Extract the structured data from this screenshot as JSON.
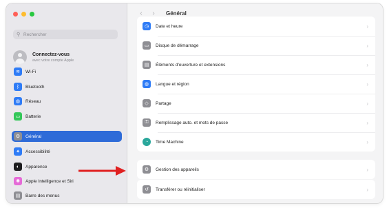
{
  "window": {
    "title": "Général",
    "traffic_colors": [
      "#ff5f57",
      "#febc2e",
      "#28c840"
    ]
  },
  "sidebar": {
    "search_placeholder": "Rechercher",
    "account": {
      "title": "Connectez-vous",
      "subtitle": "avec votre compte Apple"
    },
    "items": [
      {
        "label": "Wi-Fi",
        "icon": "wifi-icon",
        "color": "#2f7cf6",
        "glyph": "≋",
        "selected": false
      },
      {
        "label": "Bluetooth",
        "icon": "bluetooth-icon",
        "color": "#2f7cf6",
        "glyph": "ᛒ",
        "selected": false
      },
      {
        "label": "Réseau",
        "icon": "globe-icon",
        "color": "#2f7cf6",
        "glyph": "◍",
        "selected": false
      },
      {
        "label": "Batterie",
        "icon": "battery-icon",
        "color": "#34c759",
        "glyph": "▭",
        "selected": false
      },
      {
        "label": "Général",
        "icon": "gear-icon",
        "color": "#8e8e93",
        "glyph": "⚙",
        "selected": true
      },
      {
        "label": "Accessibilité",
        "icon": "accessibility-icon",
        "color": "#2f7cf6",
        "glyph": "✦",
        "selected": false
      },
      {
        "label": "Apparence",
        "icon": "appearance-icon",
        "color": "#1c1c1e",
        "glyph": "◐",
        "selected": false
      },
      {
        "label": "Apple Intelligence et Siri",
        "icon": "siri-icon",
        "color": "#e56bd7",
        "glyph": "✺",
        "selected": false
      },
      {
        "label": "Barre des menus",
        "icon": "menubar-icon",
        "color": "#8e8e93",
        "glyph": "▤",
        "selected": false
      }
    ]
  },
  "main": {
    "groups": [
      {
        "rows": [
          {
            "label": "Date et heure",
            "icon": "calendar-clock-icon",
            "color": "#2f7cf6",
            "glyph": "◷"
          },
          {
            "label": "Disque de démarrage",
            "icon": "startup-disk-icon",
            "color": "#8e8e93",
            "glyph": "▭"
          },
          {
            "label": "Éléments d'ouverture et extensions",
            "icon": "login-items-icon",
            "color": "#8e8e93",
            "glyph": "▤"
          },
          {
            "label": "Langue et région",
            "icon": "language-globe-icon",
            "color": "#2f7cf6",
            "glyph": "◍"
          },
          {
            "label": "Partage",
            "icon": "sharing-icon",
            "color": "#8e8e93",
            "glyph": "◇"
          },
          {
            "label": "Remplissage auto. et mots de passe",
            "icon": "key-icon",
            "color": "#8e8e93",
            "glyph": "⚿"
          },
          {
            "label": "Time Machine",
            "icon": "time-machine-icon",
            "color": "#2aa79b",
            "glyph": "◔"
          }
        ]
      },
      {
        "rows": [
          {
            "label": "Gestion des appareils",
            "icon": "device-management-icon",
            "color": "#8e8e93",
            "glyph": "⚙"
          }
        ]
      },
      {
        "rows": [
          {
            "label": "Transférer ou réinitialiser",
            "icon": "reset-icon",
            "color": "#8e8e93",
            "glyph": "↺"
          }
        ]
      }
    ]
  },
  "annotation": {
    "arrow_color": "#e02020"
  }
}
